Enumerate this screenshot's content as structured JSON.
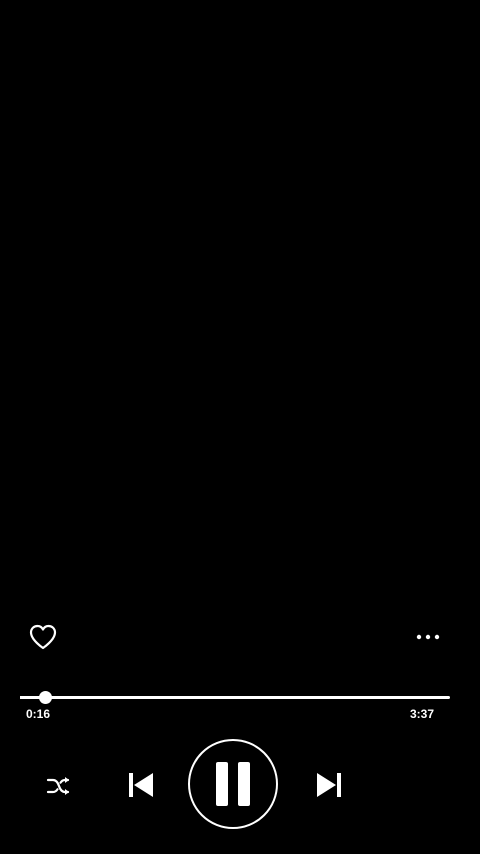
{
  "colors": {
    "background": "#000000",
    "foreground": "#ffffff"
  },
  "player": {
    "progress_fraction": 0.057,
    "elapsed": "0:16",
    "duration": "3:37",
    "state": "playing"
  },
  "icons": {
    "like": "heart-outline-icon",
    "more": "more-horizontal-icon",
    "shuffle": "shuffle-icon",
    "previous": "skip-previous-icon",
    "pause": "pause-icon",
    "next": "skip-next-icon"
  }
}
